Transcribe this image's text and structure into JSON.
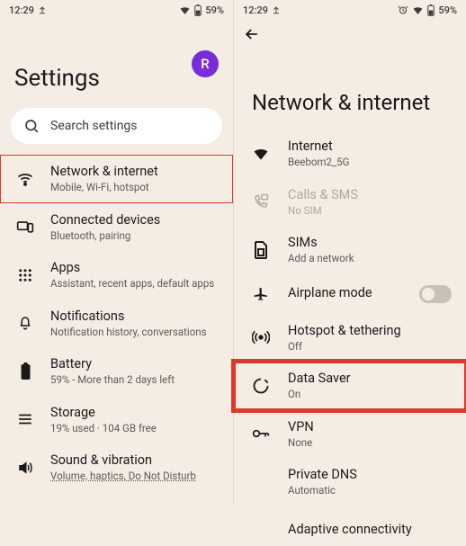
{
  "colors": {
    "accent": "#772dd8",
    "highlight": "#d93a2a"
  },
  "left_status": {
    "time": "12:29",
    "battery_pct": "59%"
  },
  "right_status": {
    "time": "12:29",
    "battery_pct": "59%"
  },
  "avatar_letter": "R",
  "settings_title": "Settings",
  "search": {
    "placeholder": "Search settings"
  },
  "settings_items": [
    {
      "title": "Network & internet",
      "sub": "Mobile, Wi-Fi, hotspot"
    },
    {
      "title": "Connected devices",
      "sub": "Bluetooth, pairing"
    },
    {
      "title": "Apps",
      "sub": "Assistant, recent apps, default apps"
    },
    {
      "title": "Notifications",
      "sub": "Notification history, conversations"
    },
    {
      "title": "Battery",
      "sub": "59% - More than 2 days left"
    },
    {
      "title": "Storage",
      "sub": "19% used · 104 GB free"
    },
    {
      "title": "Sound & vibration",
      "sub": "Volume, haptics, Do Not Disturb"
    }
  ],
  "net_title": "Network & internet",
  "net_items": {
    "internet": {
      "title": "Internet",
      "sub": "Beebom2_5G"
    },
    "calls": {
      "title": "Calls & SMS",
      "sub": "No SIM"
    },
    "sims": {
      "title": "SIMs",
      "sub": "Add a network"
    },
    "airplane": {
      "title": "Airplane mode"
    },
    "hotspot": {
      "title": "Hotspot & tethering",
      "sub": "Off"
    },
    "datasaver": {
      "title": "Data Saver",
      "sub": "On"
    },
    "vpn": {
      "title": "VPN",
      "sub": "None"
    },
    "privatedns": {
      "title": "Private DNS",
      "sub": "Automatic"
    },
    "adaptive": {
      "title": "Adaptive connectivity"
    }
  }
}
